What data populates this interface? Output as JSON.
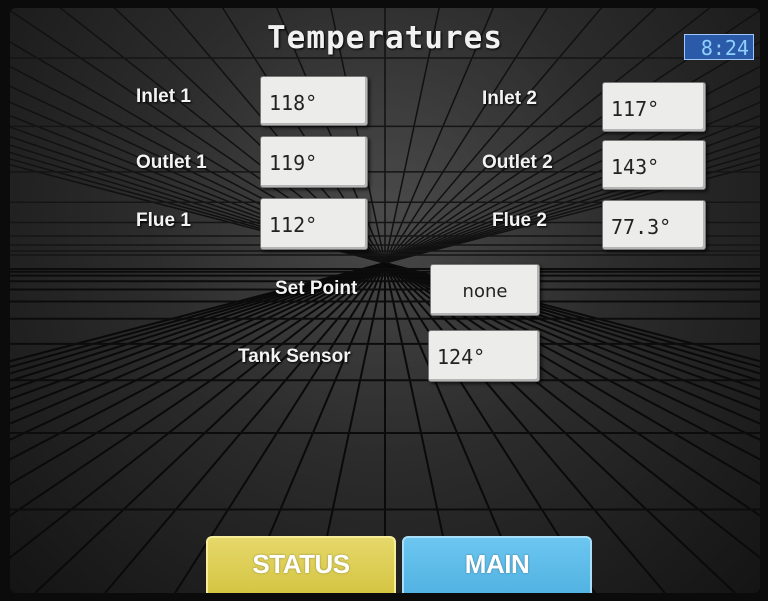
{
  "header": {
    "title": "Temperatures",
    "clock": "8:24"
  },
  "readings": {
    "inlet1": {
      "label": "Inlet 1",
      "value": "118°"
    },
    "inlet2": {
      "label": "Inlet 2",
      "value": "117°"
    },
    "outlet1": {
      "label": "Outlet 1",
      "value": "119°"
    },
    "outlet2": {
      "label": "Outlet 2",
      "value": "143°"
    },
    "flue1": {
      "label": "Flue 1",
      "value": "112°"
    },
    "flue2": {
      "label": "Flue 2",
      "value": "77.3°"
    },
    "setpoint": {
      "label": "Set Point",
      "value": "none"
    },
    "tank": {
      "label": "Tank Sensor",
      "value": "124°"
    }
  },
  "nav": {
    "status_label": "STATUS",
    "main_label": "MAIN"
  },
  "colors": {
    "clock_bg": "#2a5aa8",
    "status_button": "#d8c94a",
    "main_button": "#5ab8e6"
  }
}
